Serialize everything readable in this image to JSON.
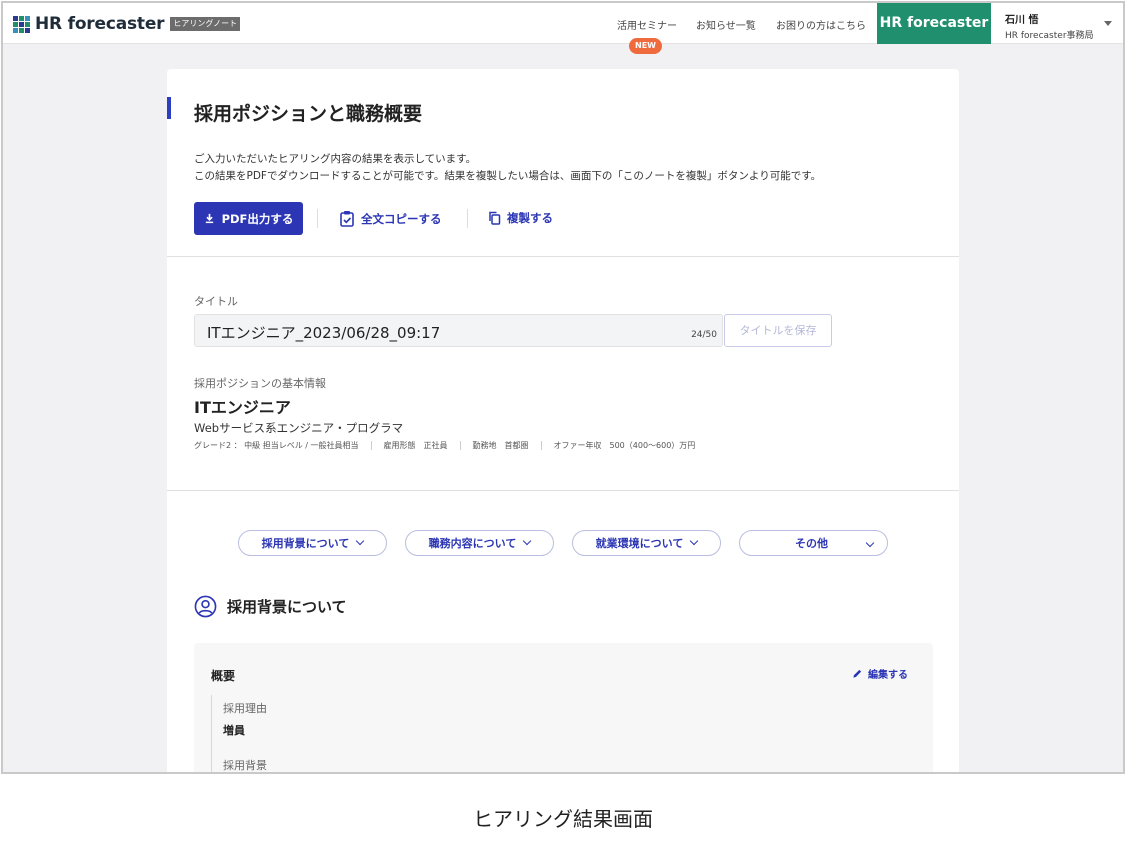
{
  "header": {
    "logo_text": "HR forecaster",
    "logo_badge": "ヒアリングノート",
    "nav": [
      "活用セミナー",
      "お知らせ一覧",
      "お困りの方はこちら"
    ],
    "new_badge": "NEW",
    "brand_button": "HR forecaster",
    "user_name": "石川 悟",
    "user_org": "HR forecaster事務局",
    "brand_color": "#1f8f6e",
    "new_color": "#ef6a3c"
  },
  "main": {
    "title": "採用ポジションと職務概要",
    "description": [
      "ご入力いただいたヒアリング内容の結果を表示しています。",
      "この結果をPDFでダウンロードすることが可能です。結果を複製したい場合は、画面下の「このノートを複製」ボタンより可能です。"
    ],
    "actions": {
      "pdf": "PDF出力する",
      "copy_all": "全文コピーする",
      "duplicate": "複製する"
    },
    "accent_color": "#2c36b4"
  },
  "title_field": {
    "label": "タイトル",
    "value": "ITエンジニア_2023/06/28_09:17",
    "counter": "24/50",
    "save_label": "タイトルを保存"
  },
  "position": {
    "section_label": "採用ポジションの基本情報",
    "title": "ITエンジニア",
    "subtitle": "Webサービス系エンジニア・プログラマ",
    "meta": [
      "グレード2 ： 中級 担当レベル / 一般社員相当",
      "雇用形態　正社員",
      "勤務地　首都圏",
      "オファー年収　500（400〜600）万円"
    ]
  },
  "tabs": [
    "採用背景について",
    "職務内容について",
    "就業環境について",
    "その他"
  ],
  "section": {
    "title": "採用背景について",
    "panel_title": "概要",
    "edit_label": "編集する",
    "fields": [
      {
        "label": "採用理由",
        "value": "増員"
      },
      {
        "label": "採用背景",
        "value": ""
      }
    ]
  },
  "caption": "ヒアリング結果画面"
}
